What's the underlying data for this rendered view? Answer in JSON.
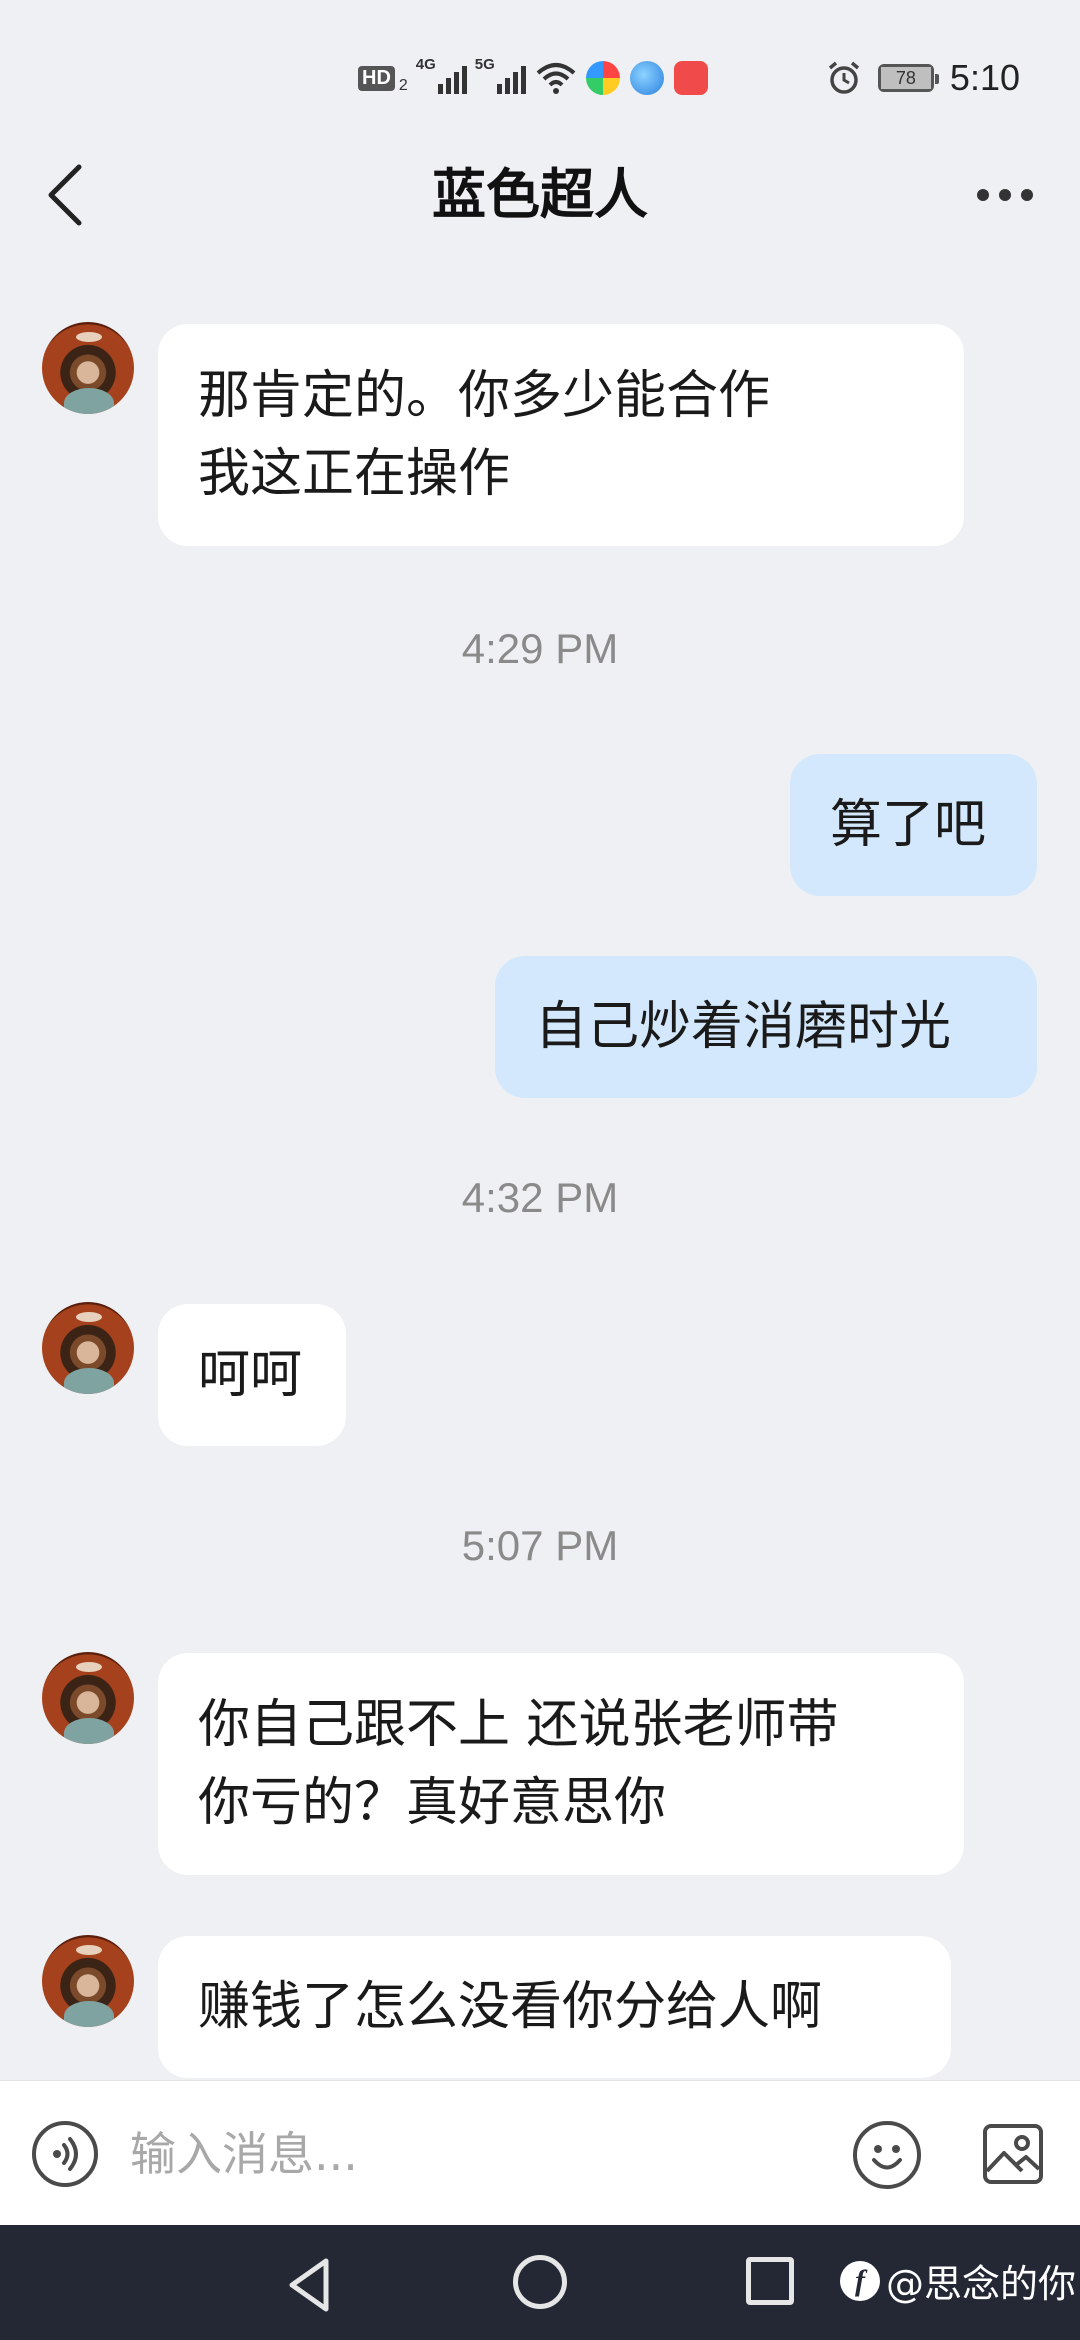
{
  "status_bar": {
    "hd_label": "HD",
    "sim_number": "2",
    "network_1": "4G",
    "network_2": "5G",
    "battery": "78",
    "time": "5:10"
  },
  "header": {
    "title": "蓝色超人"
  },
  "messages": [
    {
      "side": "received",
      "lines": [
        "那肯定的。你多少能合作",
        "我这正在操作"
      ]
    },
    {
      "type": "timestamp",
      "text": "4:29 PM"
    },
    {
      "side": "sent",
      "lines": [
        "算了吧"
      ]
    },
    {
      "side": "sent",
      "lines": [
        "自己炒着消磨时光"
      ]
    },
    {
      "type": "timestamp",
      "text": "4:32 PM"
    },
    {
      "side": "received",
      "lines": [
        "呵呵"
      ]
    },
    {
      "type": "timestamp",
      "text": "5:07 PM"
    },
    {
      "side": "received",
      "lines": [
        "你自己跟不上 还说张老师带",
        "你亏的？真好意思你"
      ]
    },
    {
      "side": "received",
      "lines": [
        "赚钱了怎么没看你分给人啊"
      ]
    }
  ],
  "input_bar": {
    "placeholder": "输入消息..."
  },
  "watermark": {
    "logo": "f",
    "text": "@思念的你"
  },
  "colors": {
    "background": "#eff0f3",
    "received_bubble": "#ffffff",
    "sent_bubble": "#d3e8fc",
    "nav_bar": "#242835"
  }
}
